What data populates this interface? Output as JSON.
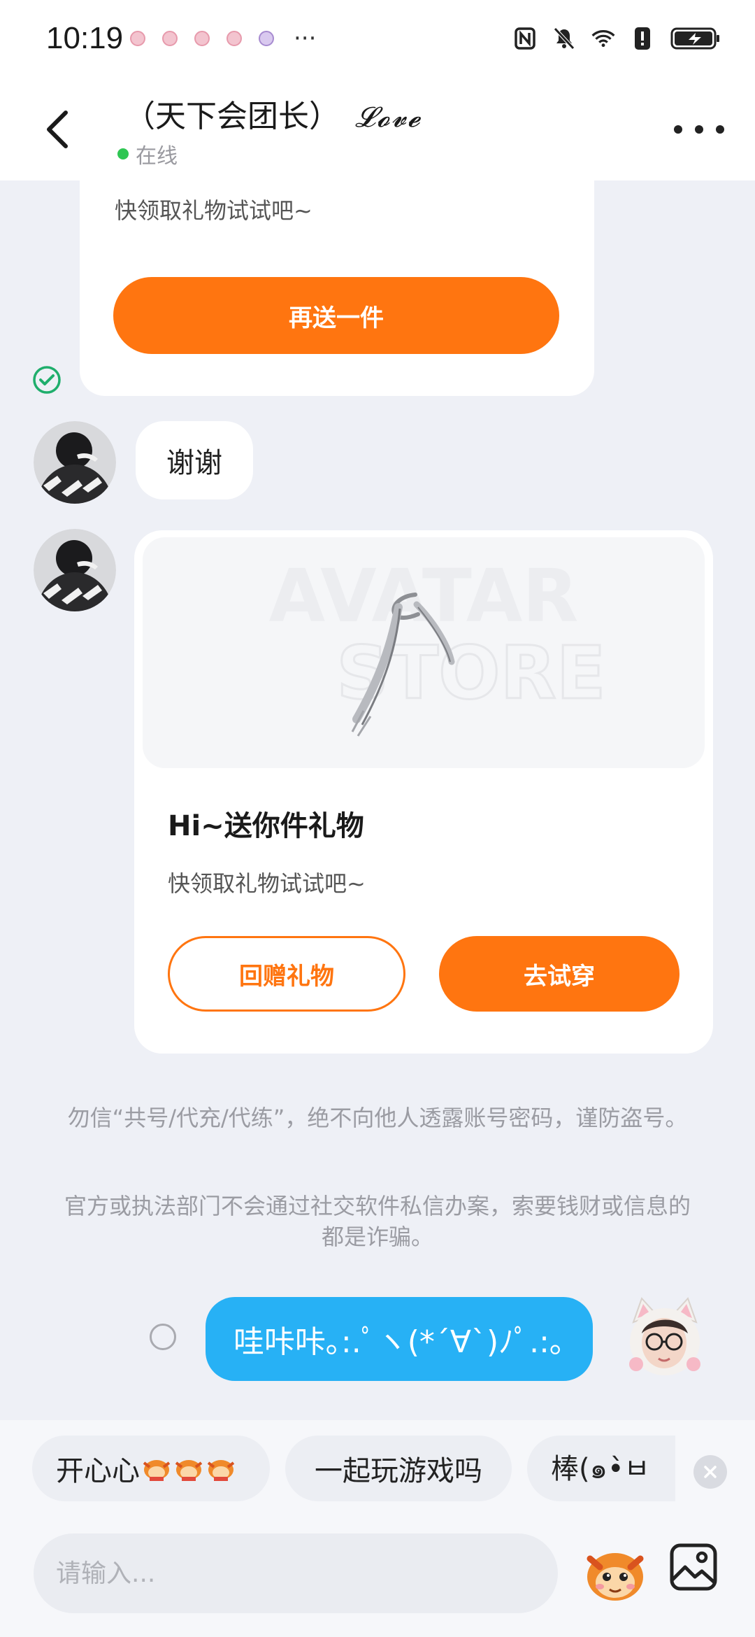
{
  "status_bar": {
    "time": "10:19",
    "more": "···",
    "icons": [
      "nfc-icon",
      "mute-icon",
      "wifi-icon",
      "alert-icon",
      "battery-charging-icon"
    ]
  },
  "header": {
    "title": "（天下会团长）",
    "title_suffix": "𝓛𝓸𝓿𝓮",
    "status": "在线"
  },
  "messages": {
    "top_card": {
      "subtitle": "快领取礼物试试吧~",
      "button": "再送一件"
    },
    "thanks": "谢谢",
    "gift_card": {
      "watermark_line1": "AVATAR",
      "watermark_line2": "STORE",
      "title": "Hi~送你件礼物",
      "subtitle": "快领取礼物试试吧~",
      "button_return": "回赠礼物",
      "button_try": "去试穿"
    },
    "notice1": "勿信“共号/代充/代练”，绝不向他人透露账号密码，谨防盗号。",
    "notice2": "官方或执法部门不会通过社交软件私信办案，索要钱财或信息的都是诈骗。",
    "my_message": "哇咔咔｡:.ﾟヽ(*´∀`)ﾉﾟ.:｡"
  },
  "quick_replies": {
    "items": [
      "开心心",
      "一起玩游戏吗",
      "棒(๑•̀ㅂ"
    ]
  },
  "composer": {
    "placeholder": "请输入..."
  },
  "colors": {
    "accent": "#ff7510",
    "bubble_blue": "#27b1f5",
    "online": "#2fc653",
    "background": "#eef0f6"
  }
}
